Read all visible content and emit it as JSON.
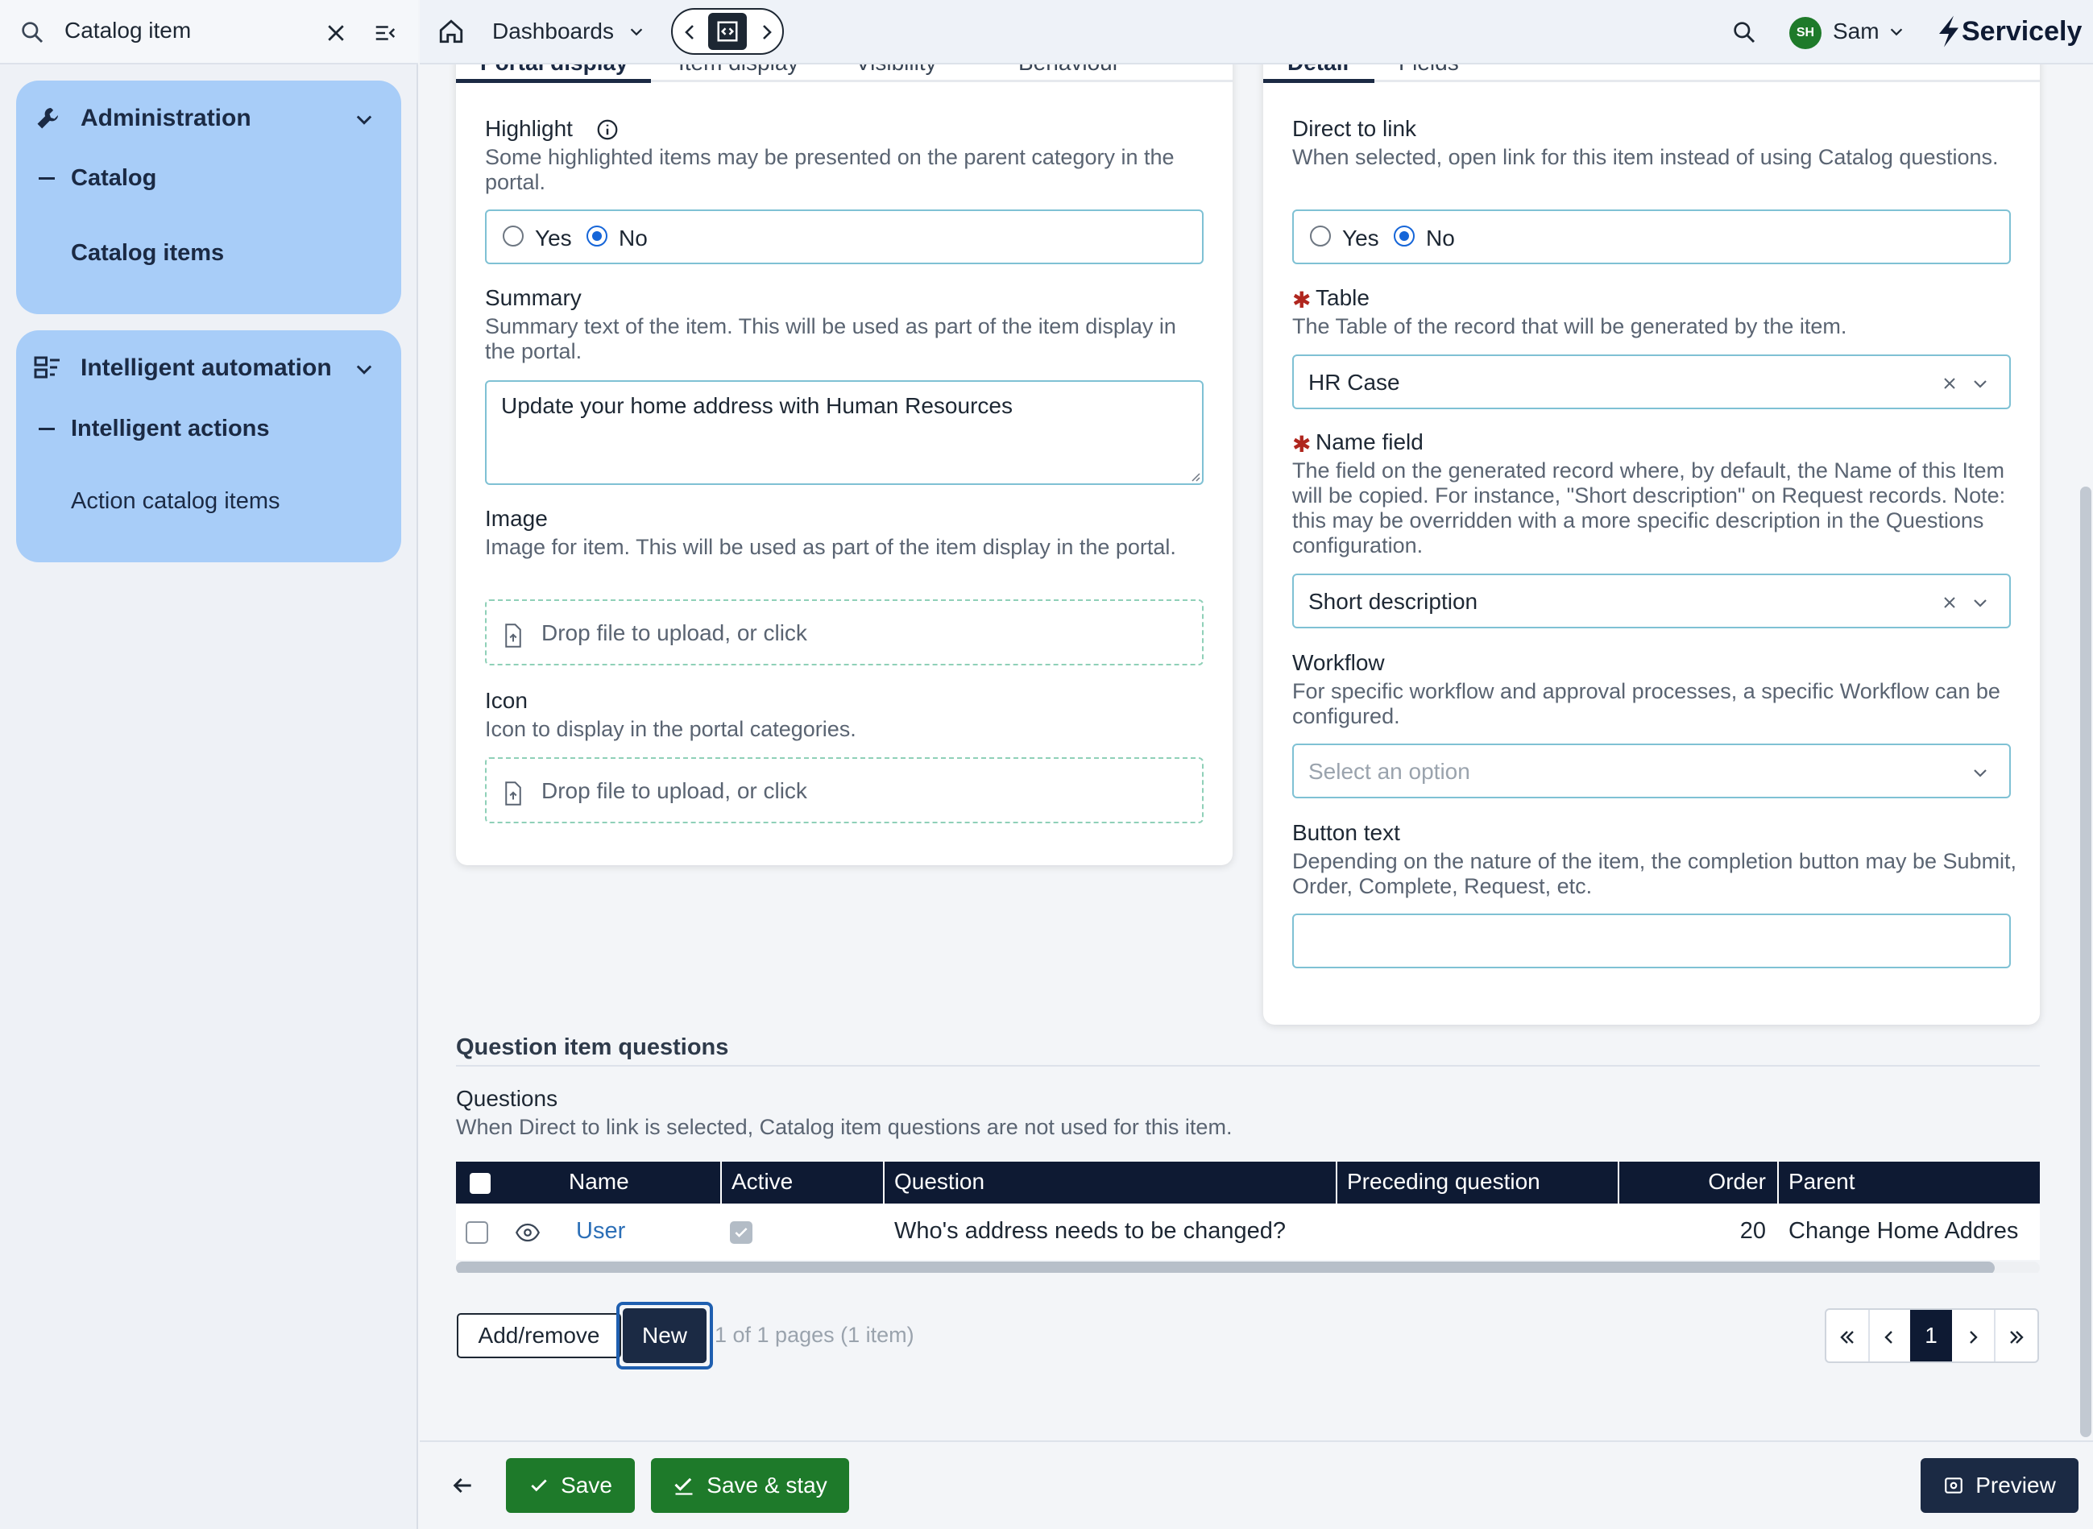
{
  "sidebar": {
    "search_value": "Catalog item",
    "sections": [
      {
        "title": "Administration",
        "sub": "Catalog",
        "leaf": "Catalog items"
      },
      {
        "title": "Intelligent automation",
        "sub": "Intelligent actions",
        "leaf": "Action catalog items"
      }
    ]
  },
  "topbar": {
    "dashboards": "Dashboards",
    "user_initials": "SH",
    "user_name": "Sam",
    "brand": "Servicely"
  },
  "left_tabs": [
    "Portal display",
    "Item display",
    "Visibility",
    "Behaviour"
  ],
  "right_tabs": [
    "Detail",
    "Fields"
  ],
  "left": {
    "highlight_label": "Highlight",
    "highlight_desc": "Some highlighted items may be presented on the parent category in the portal.",
    "yes": "Yes",
    "no": "No",
    "summary_label": "Summary",
    "summary_desc": "Summary text of the item. This will be used as part of the item display in the portal.",
    "summary_value": "Update your home address with Human Resources",
    "image_label": "Image",
    "image_desc": "Image for item. This will be used as part of the item display in the portal.",
    "dropzone": "Drop file to upload, or click",
    "icon_label": "Icon",
    "icon_desc": "Icon to display in the portal categories."
  },
  "right": {
    "direct_label": "Direct to link",
    "direct_desc": "When selected, open link for this item instead of using Catalog questions.",
    "yes": "Yes",
    "no": "No",
    "table_label": "Table",
    "table_desc": "The Table of the record that will be generated by the item.",
    "table_value": "HR Case",
    "name_label": "Name field",
    "name_desc": "The field on the generated record where, by default, the Name of this Item will be copied. For instance, \"Short description\" on Request records. Note: this may be overridden with a more specific description in the Questions configuration.",
    "name_value": "Short description",
    "workflow_label": "Workflow",
    "workflow_desc": "For specific workflow and approval processes, a specific Workflow can be configured.",
    "workflow_placeholder": "Select an option",
    "button_label": "Button text",
    "button_desc": "Depending on the nature of the item, the completion button may be Submit, Order, Complete, Request, etc."
  },
  "questions": {
    "section_title": "Question item questions",
    "label": "Questions",
    "desc": "When Direct to link is selected, Catalog item questions are not used for this item.",
    "columns": [
      "Name",
      "Active",
      "Question",
      "Preceding question",
      "Order",
      "Parent"
    ],
    "rows": [
      {
        "name": "User",
        "active": true,
        "question": "Who's address needs to be changed?",
        "preceding": "",
        "order": "20",
        "parent": "Change Home Addres"
      }
    ],
    "add_remove": "Add/remove",
    "new": "New",
    "paging": "1 of 1 pages (1 item)",
    "page": "1"
  },
  "footer": {
    "save": "Save",
    "save_stay": "Save & stay",
    "preview": "Preview"
  },
  "colors": {
    "accent": "#1e7a2a",
    "sidebar_card": "#a8cdf8",
    "table_header": "#0e1a33"
  }
}
